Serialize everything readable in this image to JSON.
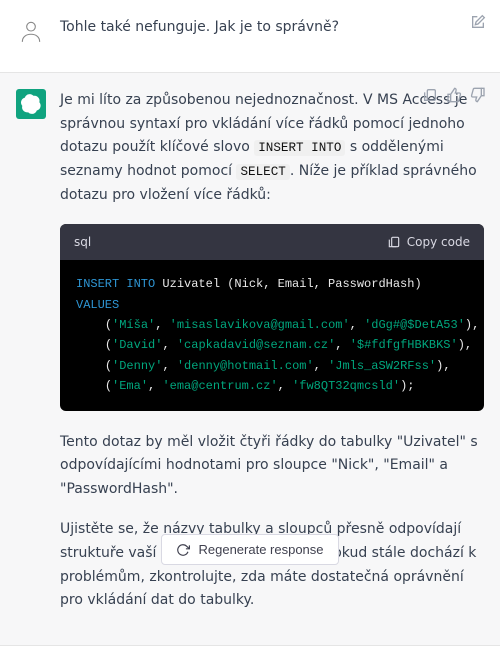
{
  "user_message": {
    "text": "Tohle také nefunguje. Jak je to správně?"
  },
  "assistant_message": {
    "intro_pre": "Je mi líto za způsobenou nejednoznačnost. V MS Access je správnou syntaxí pro vkládání více řádků pomocí jednoho dotazu použít klíčové slovo ",
    "code1": "INSERT INTO",
    "intro_mid": " s oddělenými seznamy hodnot pomocí ",
    "code2": "SELECT",
    "intro_post": ". Níže je příklad správného dotazu pro vložení více řádků:",
    "after1": "Tento dotaz by měl vložit čtyři řádky do tabulky \"Uzivatel\" s odpovídajícími hodnotami pro sloupce \"Nick\", \"Email\" a \"PasswordHash\".",
    "after2": "Ujistěte se, že názvy tabulky a sloupců přesně odpovídají struktuře vaší databáze v MS Access. Pokud stále dochází k problémům, zkontrolujte, zda máte dostatečná oprávnění pro vkládání dat do tabulky."
  },
  "codeblock": {
    "lang": "sql",
    "copy_label": "Copy code",
    "kw_insert": "INSERT INTO",
    "ident": " Uzivatel (Nick, Email, PasswordHash)",
    "kw_values": "VALUES",
    "rows": [
      {
        "nick": "'Míša'",
        "email": "'misaslavikova@gmail.com'",
        "hash": "'dGg#@$DetA53'",
        "end": ","
      },
      {
        "nick": "'David'",
        "email": "'capkadavid@seznam.cz'",
        "hash": "'$#fdfgfHBKBKS'",
        "end": ","
      },
      {
        "nick": "'Denny'",
        "email": "'denny@hotmail.com'",
        "hash": "'Jmls_aSW2RFss'",
        "end": ","
      },
      {
        "nick": "'Ema'",
        "email": "'ema@centrum.cz'",
        "hash": "'fw8QT32qmcsld'",
        "end": ";"
      }
    ]
  },
  "regen_label": "Regenerate response"
}
